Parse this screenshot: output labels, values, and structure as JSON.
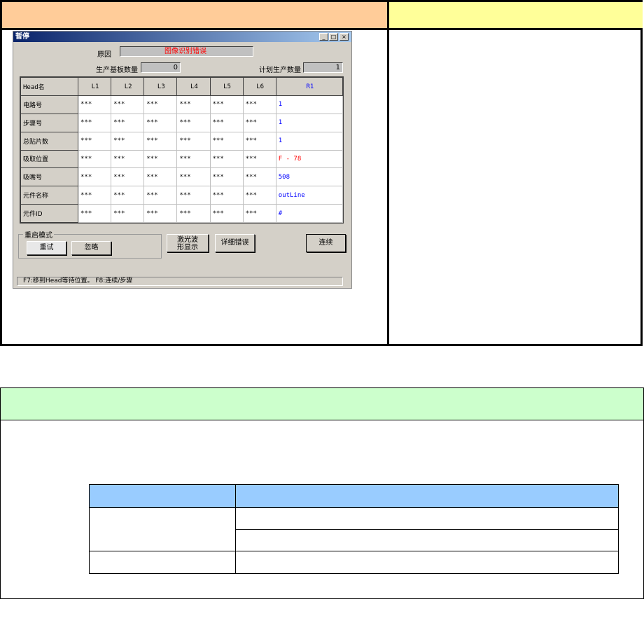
{
  "top_table": {
    "header_left": "",
    "header_right": ""
  },
  "window": {
    "title": "暂停",
    "controls": {
      "minimize": "_",
      "maximize": "□",
      "close": "×"
    },
    "reason_label": "原因",
    "reason_value": "图像识别错误",
    "produced_label": "生产基板数量",
    "produced_value": "0",
    "planned_label": "计划生产数量",
    "planned_value": "1",
    "columns": [
      "Head名",
      "L1",
      "L2",
      "L3",
      "L4",
      "L5",
      "L6",
      "R1"
    ],
    "rows": [
      {
        "label": "电路号",
        "values": [
          "***",
          "***",
          "***",
          "***",
          "***",
          "***",
          "1"
        ]
      },
      {
        "label": "步骤号",
        "values": [
          "***",
          "***",
          "***",
          "***",
          "***",
          "***",
          "1"
        ]
      },
      {
        "label": "总贴片数",
        "values": [
          "***",
          "***",
          "***",
          "***",
          "***",
          "***",
          "1"
        ]
      },
      {
        "label": "吸取位置",
        "values": [
          "***",
          "***",
          "***",
          "***",
          "***",
          "***",
          "F - 78"
        ]
      },
      {
        "label": "吸嘴号",
        "values": [
          "***",
          "***",
          "***",
          "***",
          "***",
          "***",
          "508"
        ]
      },
      {
        "label": "元件名称",
        "values": [
          "***",
          "***",
          "***",
          "***",
          "***",
          "***",
          "outLine"
        ]
      },
      {
        "label": "元件ID",
        "values": [
          "***",
          "***",
          "***",
          "***",
          "***",
          "***",
          "#"
        ]
      }
    ],
    "restart_group": "重启模式",
    "retry": "重试",
    "ignore": "忽略",
    "laser_button": "激光波形显示",
    "detail_button": "详细错误",
    "continue_button": "连续",
    "status": "F7:移到Head等待位置。   F8:连续/步骤"
  },
  "colors": {
    "header_orange": "#FFCC99",
    "header_yellow": "#FFFF99",
    "section_green": "#CCFFCC",
    "table_blue": "#99CCFF",
    "r1_blue": "#0000ff",
    "error_red": "#ff0000"
  }
}
